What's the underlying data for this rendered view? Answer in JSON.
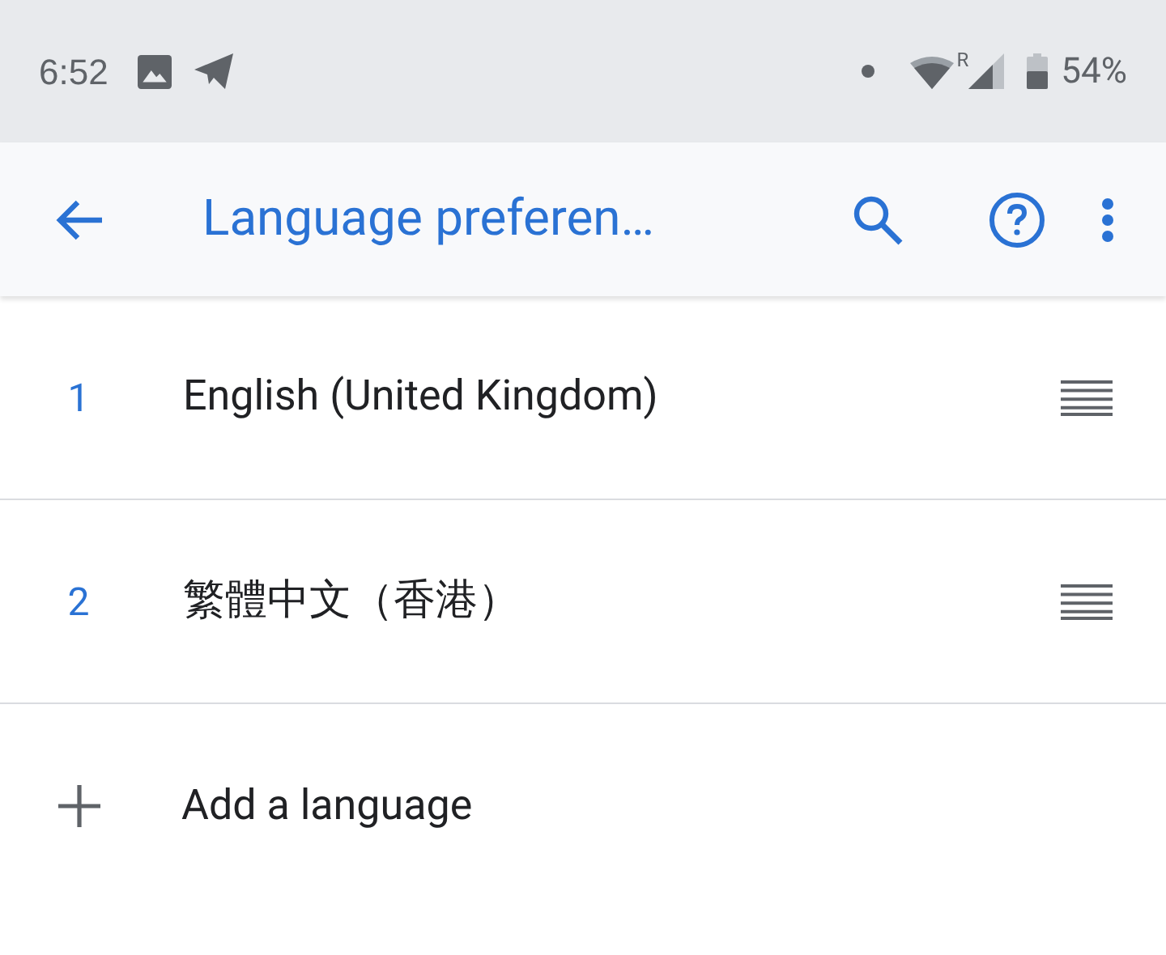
{
  "status_bar": {
    "time": "6:52",
    "roaming": "R",
    "battery": "54%"
  },
  "toolbar": {
    "title": "Language preferen…"
  },
  "languages": [
    {
      "number": "1",
      "name": "English (United Kingdom)"
    },
    {
      "number": "2",
      "name": "繁體中文（香港）"
    }
  ],
  "add_language": {
    "label": "Add a language"
  }
}
